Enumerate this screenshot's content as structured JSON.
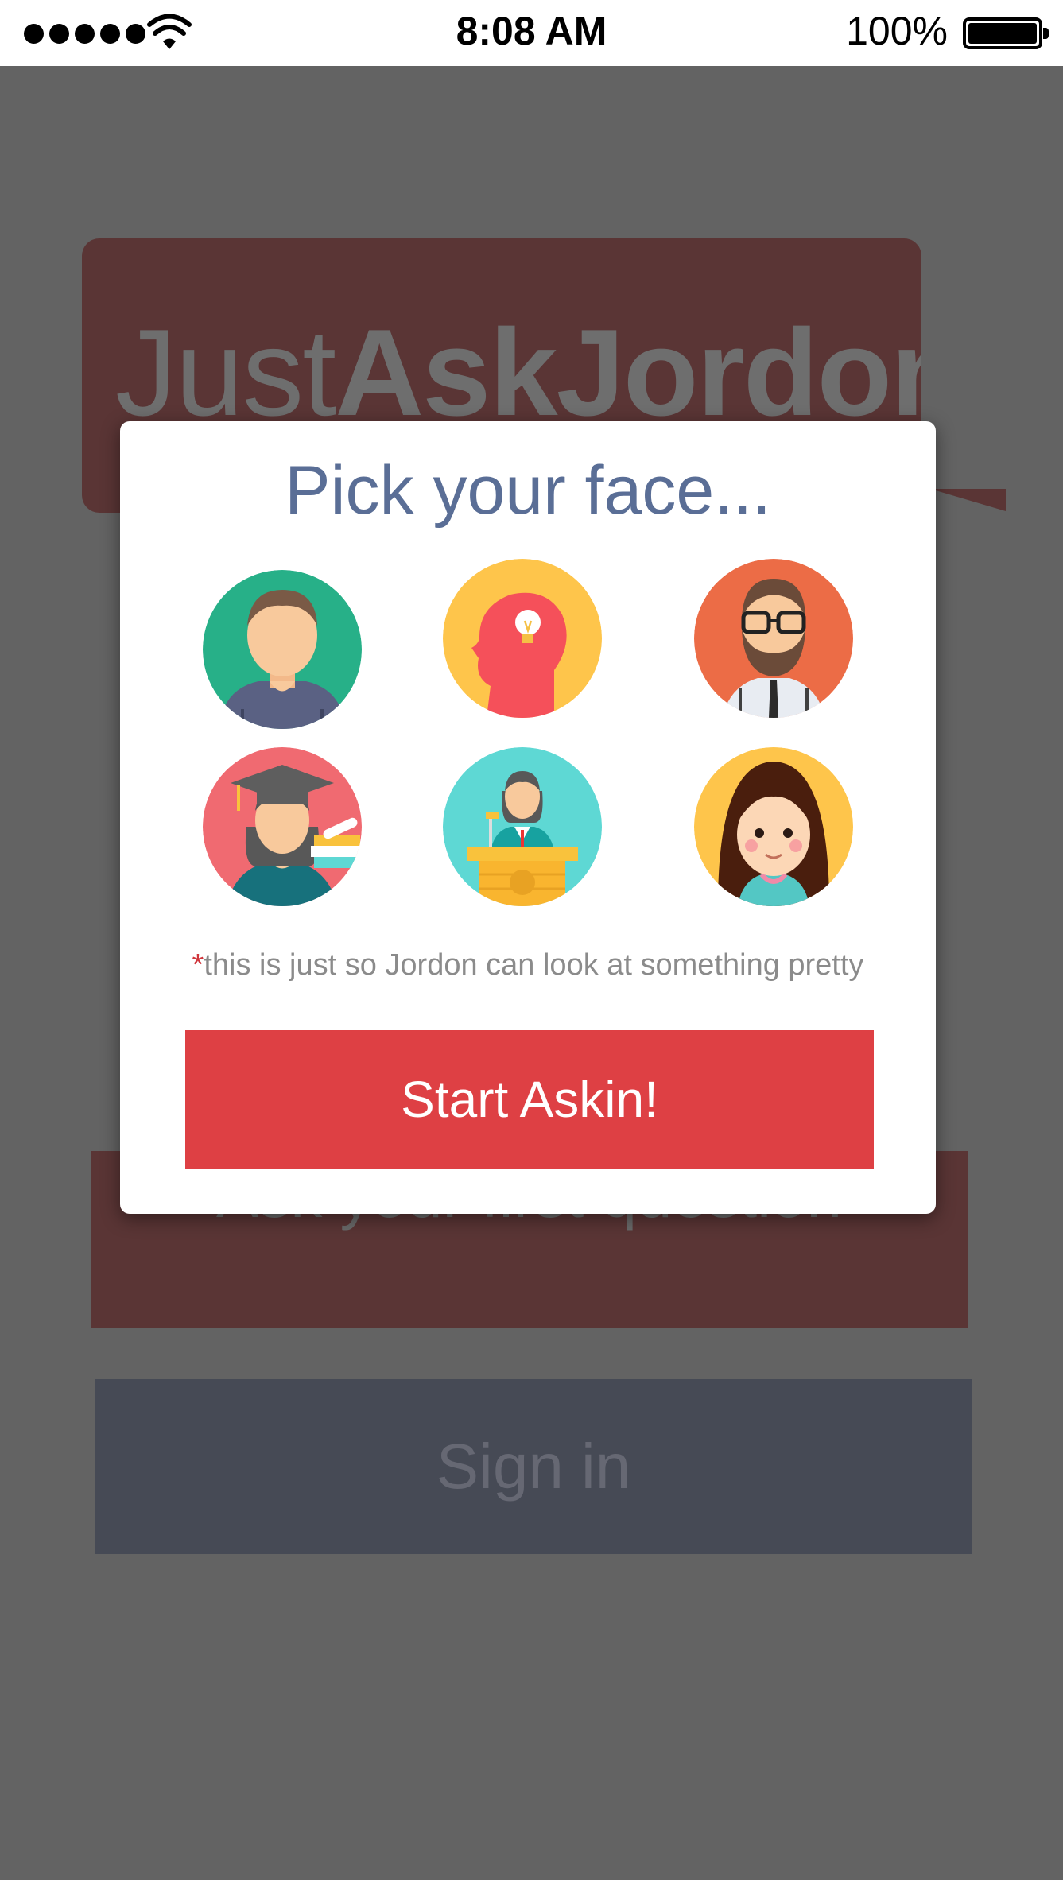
{
  "status_bar": {
    "time": "8:08 AM",
    "battery": "100%"
  },
  "background": {
    "logo": {
      "part1": "Just",
      "part2": "Ask",
      "part3": "Jordon"
    },
    "ask_button": "Ask your first question",
    "signin_button": "Sign in"
  },
  "modal": {
    "title": "Pick your face...",
    "avatars": [
      {
        "name": "man-green-avatar",
        "bg": "#27b088"
      },
      {
        "name": "head-lightbulb-avatar",
        "bg": "#fec54b"
      },
      {
        "name": "bearded-man-avatar",
        "bg": "#ec6c46"
      },
      {
        "name": "graduate-avatar",
        "bg": "#f06a71"
      },
      {
        "name": "speaker-podium-avatar",
        "bg": "#5ed8d4"
      },
      {
        "name": "girl-avatar",
        "bg": "#fec54b"
      }
    ],
    "note_star": "*",
    "note": "this is just so Jordon can look at something pretty",
    "start_button": "Start Askin!"
  },
  "colors": {
    "overlay": "#636363",
    "accent_red": "#de4044",
    "title_blue": "#5a6e96"
  }
}
